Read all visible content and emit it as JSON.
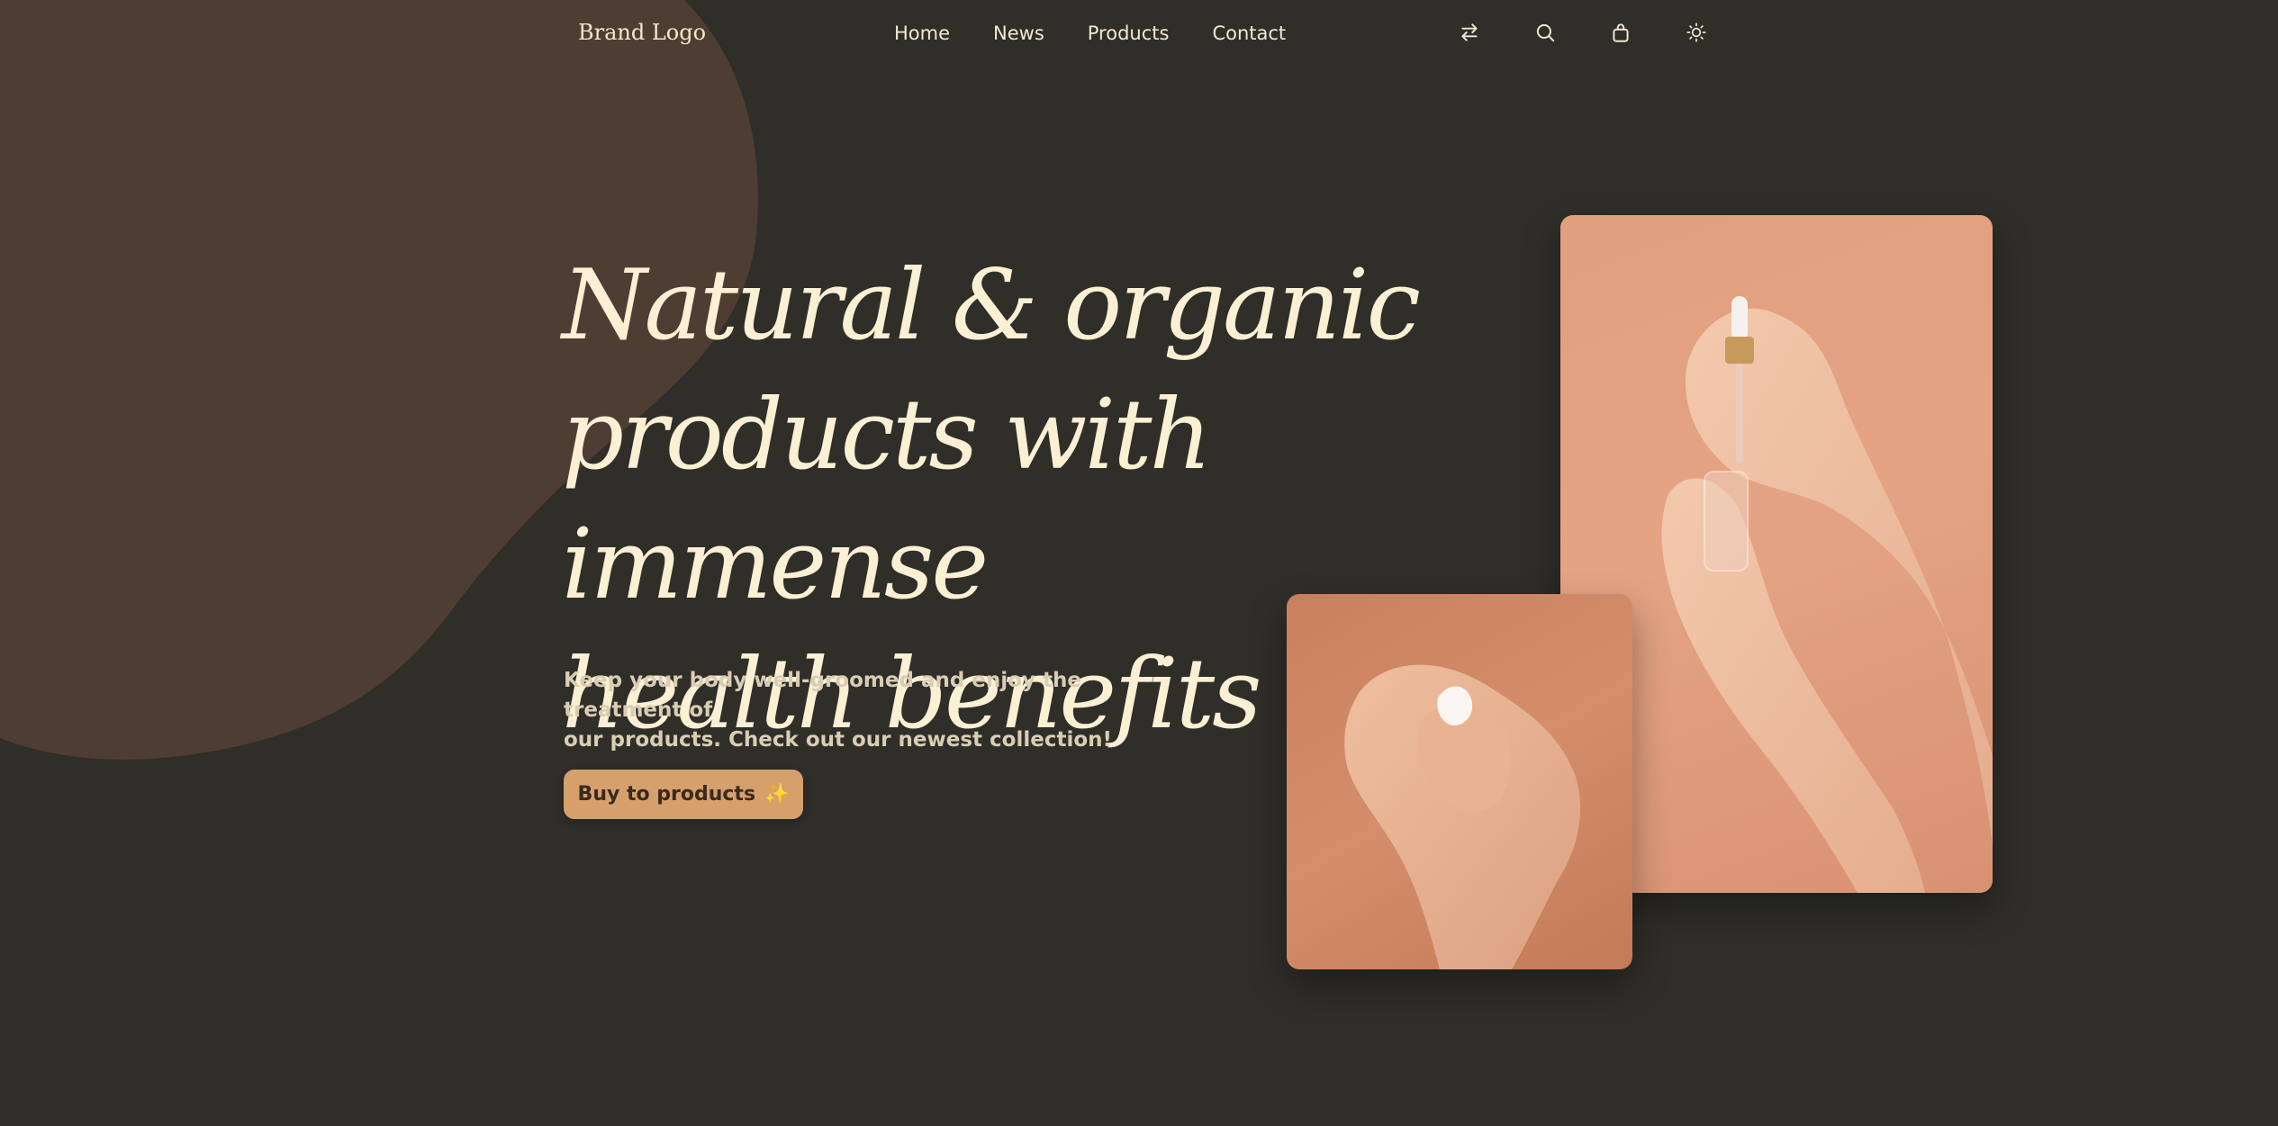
{
  "header": {
    "brand": "Brand Logo",
    "nav": [
      "Home",
      "News",
      "Products",
      "Contact"
    ],
    "icons": [
      "swap-arrows-icon",
      "search-icon",
      "shopping-bag-icon",
      "sun-theme-icon"
    ]
  },
  "hero": {
    "title_lines": [
      "Natural & organic",
      "products with immense",
      "health benefits"
    ],
    "subtitle_lines": [
      "Keep your body well-groomed and enjoy the treatment of",
      "our products. Check out our newest collection!"
    ],
    "cta_label": "Buy to products",
    "cta_icon": "sparkle-icon"
  },
  "colors": {
    "background": "#2f2e29",
    "blob": "#4e3d33",
    "title": "#fbefd4",
    "subtitle": "#d9cdb3",
    "button": "#d6a06d",
    "photo_bg": "#e09f7f"
  }
}
